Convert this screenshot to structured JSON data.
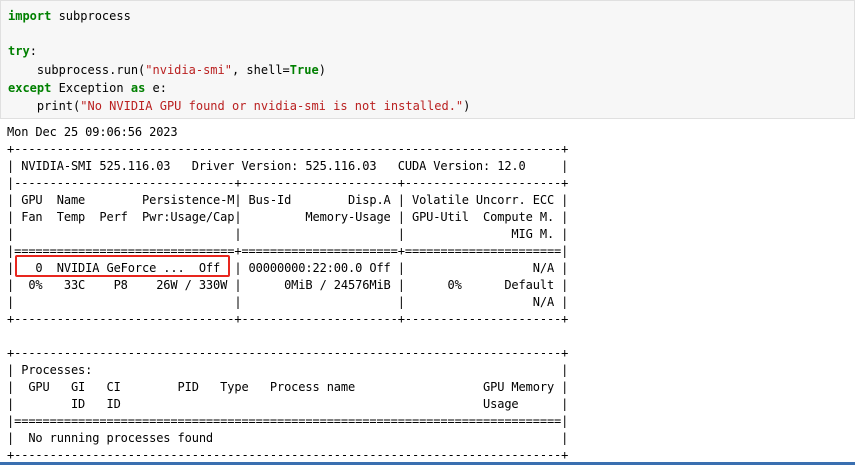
{
  "code_cell": {
    "lines": [
      {
        "segments": [
          {
            "t": "import",
            "c": "kw"
          },
          {
            "t": " subprocess",
            "c": "plain"
          }
        ]
      },
      {
        "segments": []
      },
      {
        "segments": [
          {
            "t": "try",
            "c": "kw"
          },
          {
            "t": ":",
            "c": "plain"
          }
        ]
      },
      {
        "segments": [
          {
            "t": "    subprocess.run(",
            "c": "plain"
          },
          {
            "t": "\"nvidia-smi\"",
            "c": "str"
          },
          {
            "t": ", shell=",
            "c": "plain"
          },
          {
            "t": "True",
            "c": "kw"
          },
          {
            "t": ")",
            "c": "plain"
          }
        ]
      },
      {
        "segments": [
          {
            "t": "except",
            "c": "kw"
          },
          {
            "t": " Exception ",
            "c": "plain"
          },
          {
            "t": "as",
            "c": "kw"
          },
          {
            "t": " e:",
            "c": "plain"
          }
        ]
      },
      {
        "segments": [
          {
            "t": "    print(",
            "c": "plain"
          },
          {
            "t": "\"No NVIDIA GPU found or nvidia-smi is not installed.\"",
            "c": "str"
          },
          {
            "t": ")",
            "c": "plain"
          }
        ]
      }
    ]
  },
  "output": {
    "lines": [
      "Mon Dec 25 09:06:56 2023",
      "+-----------------------------------------------------------------------------+",
      "| NVIDIA-SMI 525.116.03   Driver Version: 525.116.03   CUDA Version: 12.0     |",
      "|-------------------------------+----------------------+----------------------+",
      "| GPU  Name        Persistence-M| Bus-Id        Disp.A | Volatile Uncorr. ECC |",
      "| Fan  Temp  Perf  Pwr:Usage/Cap|         Memory-Usage | GPU-Util  Compute M. |",
      "|                               |                      |               MIG M. |",
      "|===============================+======================+======================|",
      "|   0  NVIDIA GeForce ...  Off  | 00000000:22:00.0 Off |                  N/A |",
      "|  0%   33C    P8    26W / 330W |      0MiB / 24576MiB |      0%      Default |",
      "|                               |                      |                  N/A |",
      "+-------------------------------+----------------------+----------------------+",
      "",
      "+-----------------------------------------------------------------------------+",
      "| Processes:                                                                  |",
      "|  GPU   GI   CI        PID   Type   Process name                  GPU Memory |",
      "|        ID   ID                                                   Usage      |",
      "|=============================================================================|",
      "|  No running processes found                                                 |",
      "+-----------------------------------------------------------------------------+"
    ]
  },
  "colors": {
    "keyword": "#008000",
    "string": "#ba2121",
    "highlight": "#e8261e",
    "cell_background": "#f7f7f7"
  }
}
